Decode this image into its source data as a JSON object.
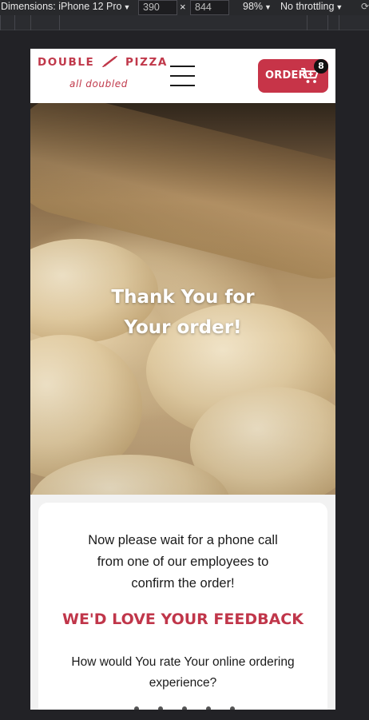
{
  "devtools": {
    "dimensions_label": "Dimensions: iPhone 12 Pro",
    "width": "390",
    "height": "844",
    "separator": "×",
    "zoom": "98%",
    "throttling": "No throttling",
    "dropdown_glyph": "▼"
  },
  "site": {
    "logo_name_left": "DOUBLE",
    "logo_name_right": "PIZZA",
    "logo_tagline": "all doubled",
    "order_label": "ORDER",
    "cart_count": "8",
    "brand_color": "#c73448"
  },
  "hero": {
    "title_line1": "Thank You for",
    "title_line2": "Your order!"
  },
  "confirmation": {
    "message_line1": "Now please wait for a phone call",
    "message_line2": "from one of our employees to",
    "message_line3": "confirm the order!",
    "feedback_heading": "WE'D LOVE YOUR FEEDBACK",
    "question_line1": "How would You rate Your online ordering",
    "question_line2": "experience?"
  }
}
